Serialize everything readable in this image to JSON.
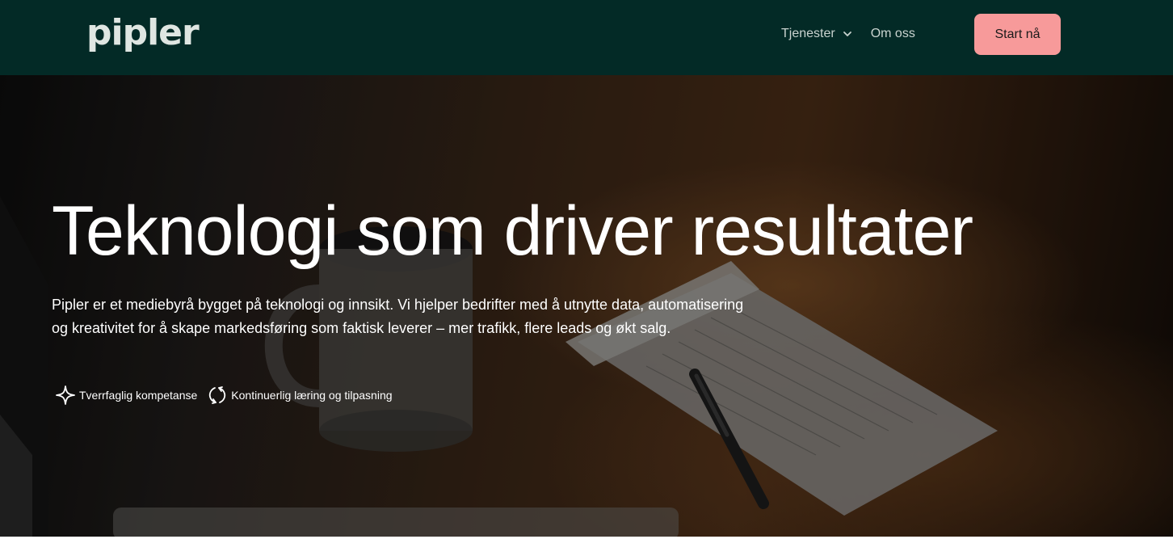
{
  "brand": {
    "logo_text": "pipler",
    "colors": {
      "header_bg": "#032a26",
      "cta_bg": "#f79a9a",
      "nav_text": "#c9d3cf"
    }
  },
  "nav": {
    "items": [
      {
        "label": "Tjenester",
        "has_dropdown": true,
        "icon": "chevron-down-icon"
      },
      {
        "label": "Om oss",
        "has_dropdown": false
      }
    ],
    "cta_label": "Start nå"
  },
  "hero": {
    "title": "Teknologi som driver resultater",
    "description": "Pipler er et mediebyrå bygget på teknologi og innsikt. Vi hjelper bedrifter med å utnytte data, automatisering og kreativitet for å skape markedsføring som faktisk leverer – mer trafikk, flere leads og økt salg.",
    "features": [
      {
        "icon": "sparkle-icon",
        "label": "Tverrfaglig kompetanse"
      },
      {
        "icon": "refresh-icon",
        "label": "Kontinuerlig læring og tilpasning"
      }
    ]
  }
}
